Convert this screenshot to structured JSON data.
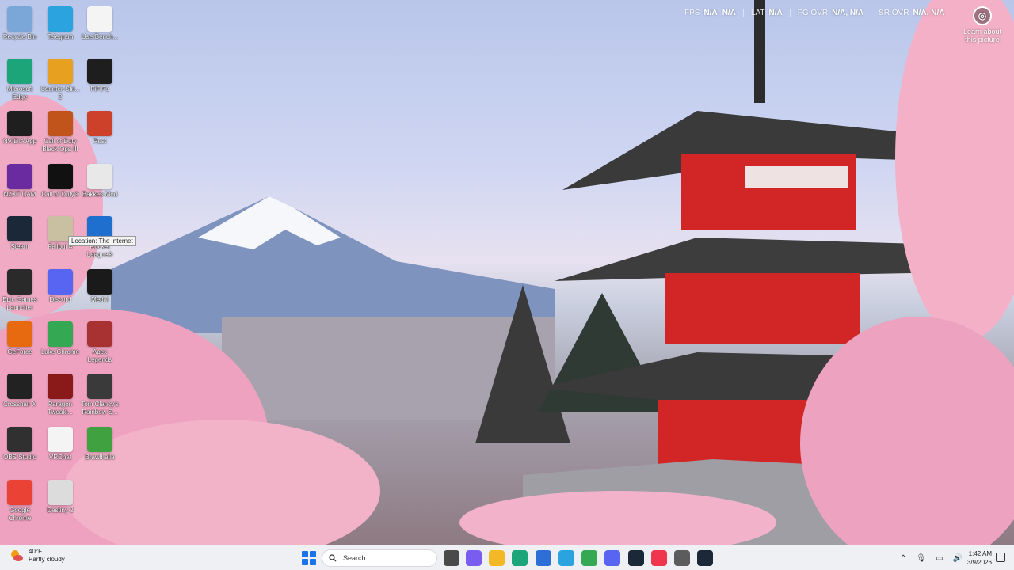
{
  "overlay": {
    "fps_label": "FPS",
    "fps_val1": "N/A",
    "fps_val2": "N/A",
    "lat_label": "LAT",
    "lat_val": "N/A",
    "fg_label": "FG OVR",
    "fg_val": "N/A, N/A",
    "sr_label": "SR OVR",
    "sr_val": "N/A, N/A"
  },
  "learn": {
    "label": "Learn about this picture"
  },
  "tooltip": "Location: The Internet",
  "desktop_icons": [
    {
      "label": "Recycle Bin",
      "icon": "recycle-bin-icon",
      "color": "#7aa6d8"
    },
    {
      "label": "Telegram",
      "icon": "telegram-icon",
      "color": "#2aa3df"
    },
    {
      "label": "UserBench...",
      "icon": "userbenchmark-icon",
      "color": "#f4f4f4"
    },
    {
      "label": "Microsoft Edge",
      "icon": "edge-icon",
      "color": "#1da57a"
    },
    {
      "label": "Counter-Stri... 2",
      "icon": "cs2-icon",
      "color": "#e8a020"
    },
    {
      "label": "FiFiPo",
      "icon": "fifipo-icon",
      "color": "#1e1e1e"
    },
    {
      "label": "NVIDIA App",
      "icon": "nvidia-icon",
      "color": "#1f1f1f"
    },
    {
      "label": "Call of Duty Black Ops III",
      "icon": "bo3-icon",
      "color": "#c1541b"
    },
    {
      "label": "Rust",
      "icon": "rust-icon",
      "color": "#cd412b"
    },
    {
      "label": "NZXT CAM",
      "icon": "nzxt-icon",
      "color": "#6a2ba0"
    },
    {
      "label": "Call of Duty®",
      "icon": "cod-icon",
      "color": "#111111"
    },
    {
      "label": "Bakkes-Mod",
      "icon": "bakkesmod-icon",
      "color": "#e8e8e8"
    },
    {
      "label": "Steam",
      "icon": "steam-icon",
      "color": "#1b2838"
    },
    {
      "label": "Fallout 4",
      "icon": "fallout-icon",
      "color": "#c8c0a0"
    },
    {
      "label": "Rocket League®",
      "icon": "rocket-league-icon",
      "color": "#1f6fcf"
    },
    {
      "label": "Epic Games Launcher",
      "icon": "epic-icon",
      "color": "#2a2a2a"
    },
    {
      "label": "Discord",
      "icon": "discord-icon",
      "color": "#5865f2"
    },
    {
      "label": "Medal",
      "icon": "medal-icon",
      "color": "#1a1a1a"
    },
    {
      "label": "GeForce",
      "icon": "geforce-icon",
      "color": "#e86a10"
    },
    {
      "label": "Lake Chrome",
      "icon": "chrome-icon",
      "color": "#34a853"
    },
    {
      "label": "Apex Legends",
      "icon": "apex-icon",
      "color": "#a83232"
    },
    {
      "label": "Crosshair X",
      "icon": "crosshair-icon",
      "color": "#222222"
    },
    {
      "label": "Paragon Tweaki...",
      "icon": "paragon-icon",
      "color": "#8a1a1a"
    },
    {
      "label": "Tom Clancy's Rainbow S...",
      "icon": "rainbow-six-icon",
      "color": "#3a3a3a"
    },
    {
      "label": "OBS Studio",
      "icon": "obs-icon",
      "color": "#303030"
    },
    {
      "label": "VRChat",
      "icon": "vrchat-icon",
      "color": "#f4f4f4"
    },
    {
      "label": "Brawlhalla",
      "icon": "brawlhalla-icon",
      "color": "#3fa13f"
    },
    {
      "label": "Google Chrome",
      "icon": "chrome-icon",
      "color": "#ea4335"
    },
    {
      "label": "Destiny 2",
      "icon": "destiny-icon",
      "color": "#dcdcdc"
    }
  ],
  "taskbar": {
    "weather_temp": "40°F",
    "weather_desc": "Partly cloudy",
    "search_placeholder": "Search",
    "time": "1:42 AM",
    "date": "3/9/2026",
    "pinned": [
      {
        "name": "task-view-icon",
        "color": "#4a4a4a"
      },
      {
        "name": "copilot-icon",
        "color": "#7b5cf0"
      },
      {
        "name": "file-explorer-icon",
        "color": "#f2b826"
      },
      {
        "name": "edge-icon",
        "color": "#1da57a"
      },
      {
        "name": "store-icon",
        "color": "#2d6fd6"
      },
      {
        "name": "telegram-icon",
        "color": "#2aa3df"
      },
      {
        "name": "chrome-icon",
        "color": "#34a853"
      },
      {
        "name": "discord-icon",
        "color": "#5865f2"
      },
      {
        "name": "steam-icon",
        "color": "#1b2838"
      },
      {
        "name": "itunes-icon",
        "color": "#f0354f"
      },
      {
        "name": "settings-icon",
        "color": "#5c5c5c"
      },
      {
        "name": "steam-icon",
        "color": "#1b2838"
      }
    ]
  }
}
